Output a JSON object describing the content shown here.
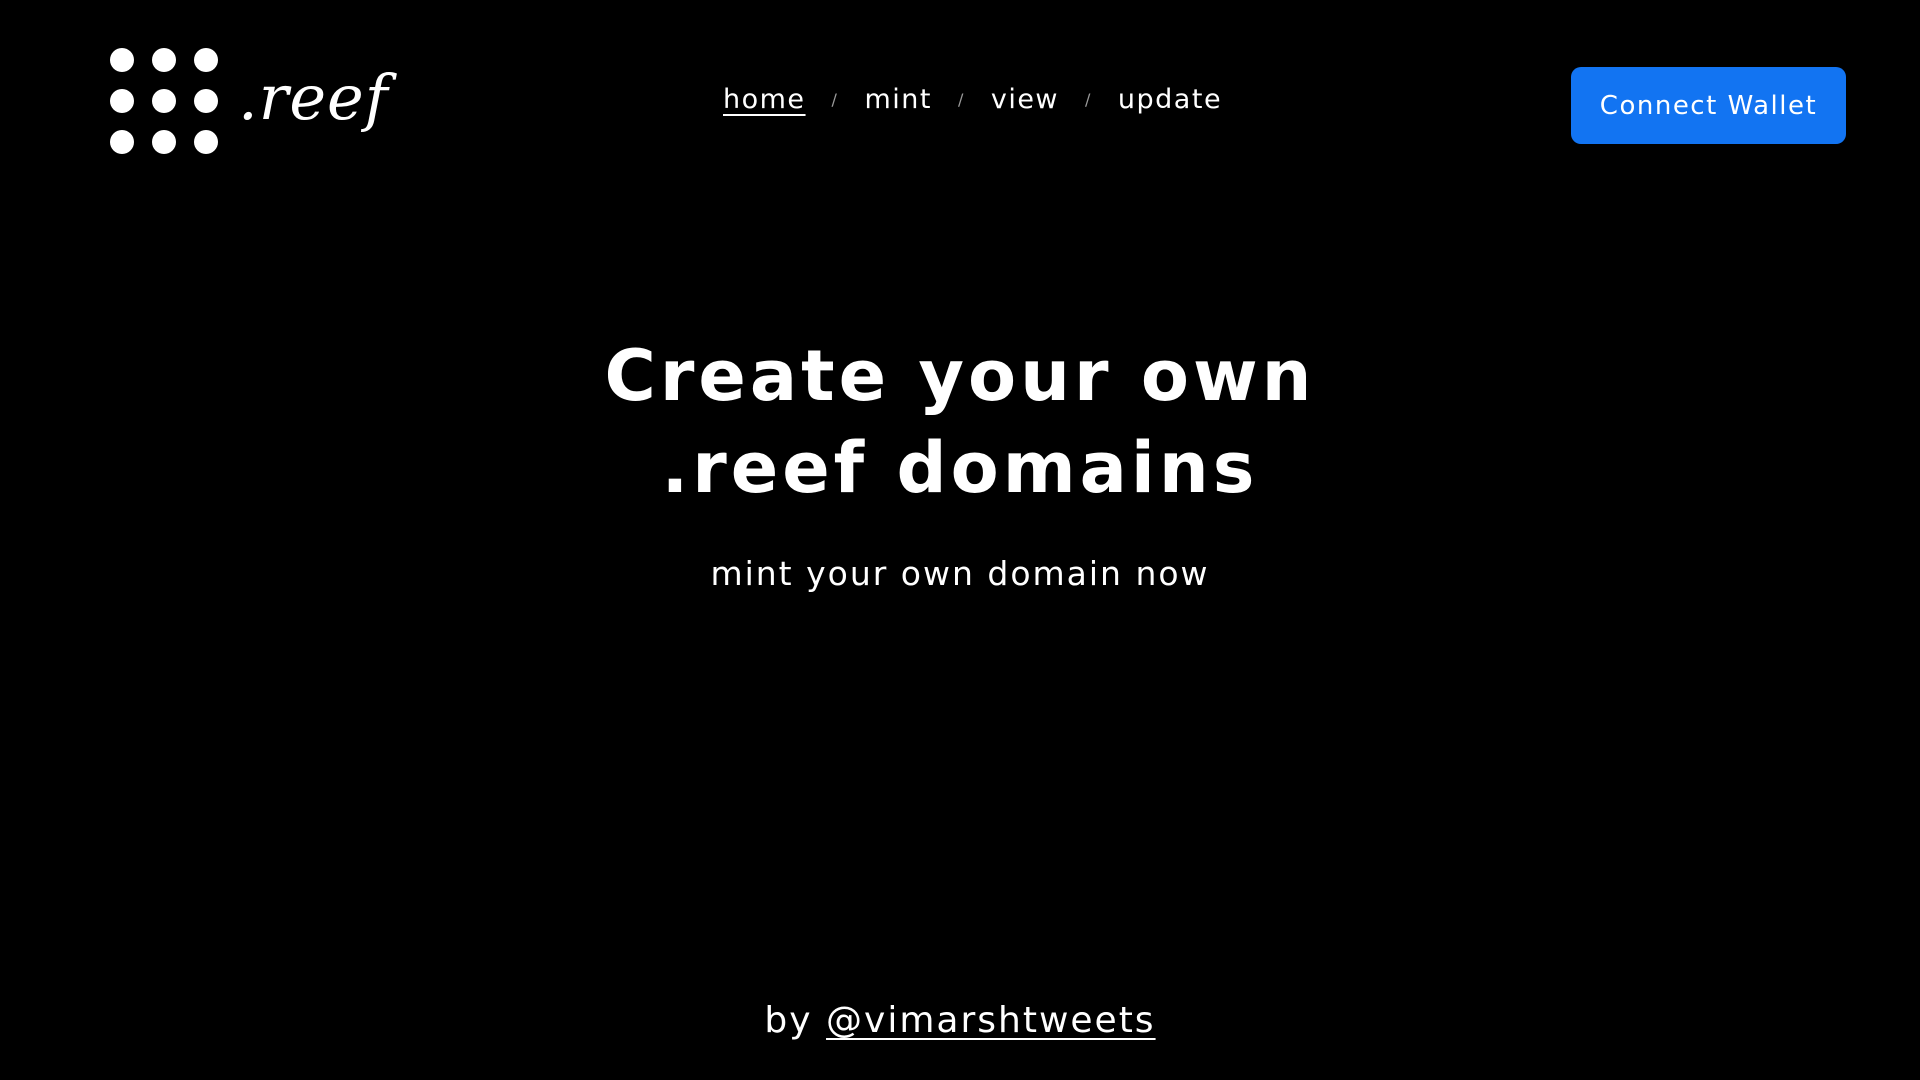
{
  "header": {
    "logo": {
      "text": ".reef",
      "icon": "nine-dots-logo-icon"
    },
    "nav": {
      "items": [
        {
          "label": "home",
          "active": true
        },
        {
          "label": "mint",
          "active": false
        },
        {
          "label": "view",
          "active": false
        },
        {
          "label": "update",
          "active": false
        }
      ],
      "separator": "/"
    },
    "connect_label": "Connect Wallet"
  },
  "hero": {
    "title_line1": "Create your own",
    "title_line2": ".reef domains",
    "subtitle": "mint your own domain now"
  },
  "footer": {
    "prefix": "by",
    "handle": "@vimarshtweets"
  },
  "colors": {
    "background": "#000000",
    "text": "#ffffff",
    "accent": "#1274f2"
  }
}
